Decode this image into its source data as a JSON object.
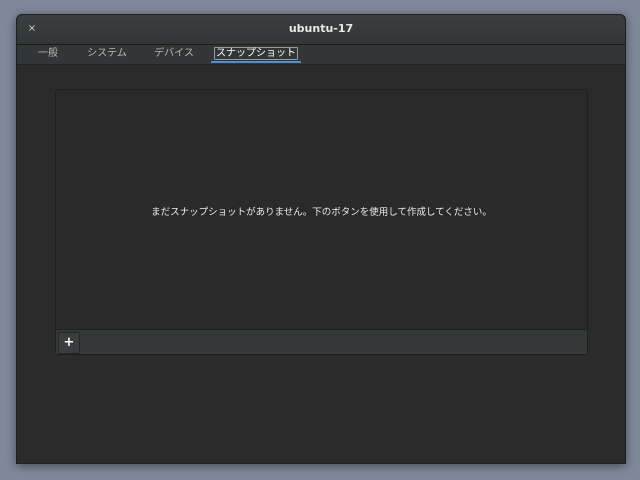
{
  "window": {
    "title": "ubuntu-17",
    "close_glyph": "×"
  },
  "tabs": [
    {
      "label": "一般",
      "active": false
    },
    {
      "label": "システム",
      "active": false
    },
    {
      "label": "デバイス",
      "active": false
    },
    {
      "label": "スナップショット",
      "active": true
    }
  ],
  "snapshots": {
    "empty_message": "まだスナップショットがありません。下のボタンを使用して作成してください。",
    "add_button_glyph": "+"
  },
  "colors": {
    "accent": "#4a8fd8",
    "window_bg": "#2b2b2b",
    "desktop_bg": "#7f889b"
  }
}
